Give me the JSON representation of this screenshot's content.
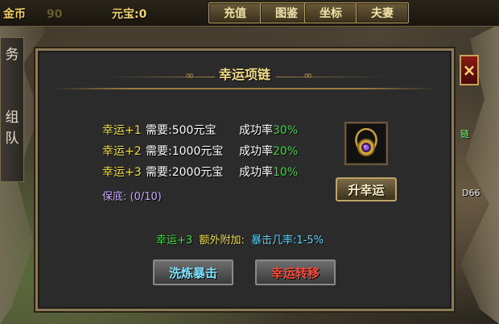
{
  "hud": {
    "gold_label": "金币",
    "gold_value_visible": "90",
    "yuanbao": "元宝:0",
    "buttons": [
      "充值",
      "图鉴",
      "坐标",
      "夫妻"
    ]
  },
  "side_tab": [
    "务",
    "组",
    "队"
  ],
  "right_labels": [
    "链",
    "D66"
  ],
  "dialog": {
    "title": "幸运项链",
    "close_label": "×",
    "rows": [
      {
        "luck": "幸运+1",
        "need": "需要:500元宝",
        "rate_label": "成功率",
        "rate": "30%"
      },
      {
        "luck": "幸运+2",
        "need": "需要:1000元宝",
        "rate_label": "成功率",
        "rate": "20%"
      },
      {
        "luck": "幸运+3",
        "need": "需要:2000元宝",
        "rate_label": "成功率",
        "rate": "10%"
      }
    ],
    "guarantee": "保底: (0/10)",
    "upgrade_button": "升幸运",
    "bonus": {
      "luck": "幸运+3",
      "extra": "额外附加:",
      "crit": "暴击几率:1-5%"
    },
    "wash_button": "洗炼暴击",
    "move_button": "幸运转移"
  },
  "colors": {
    "title": "#f3dc82",
    "luck_text": "#f2e04a",
    "rate_green": "#43d643",
    "crit_blue": "#5ad8ff",
    "move_red": "#ff4a3a"
  }
}
